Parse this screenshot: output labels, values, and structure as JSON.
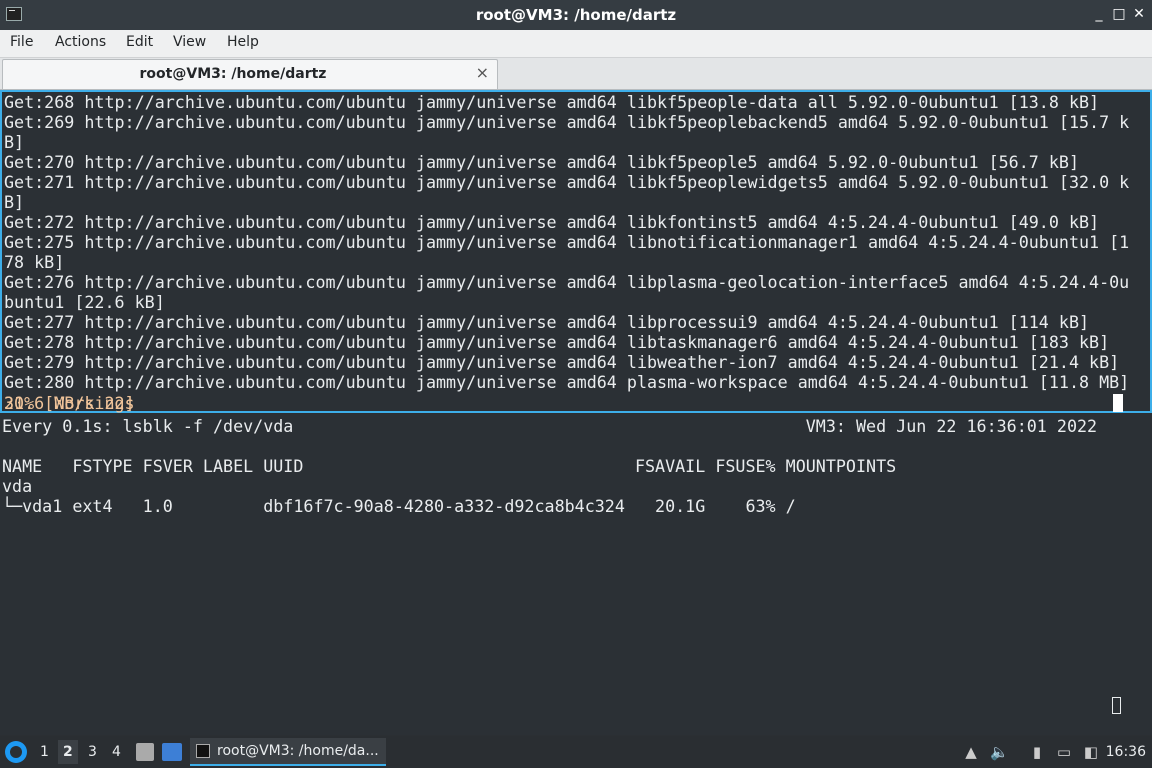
{
  "window": {
    "title": "root@VM3: /home/dartz",
    "controls": {
      "minimize": "_",
      "maximize": "□",
      "close": "✕"
    }
  },
  "menu": [
    "File",
    "Actions",
    "Edit",
    "View",
    "Help"
  ],
  "tab": {
    "label": "root@VM3: /home/dartz",
    "close": "×"
  },
  "pane1": {
    "lines": [
      "Get:268 http://archive.ubuntu.com/ubuntu jammy/universe amd64 libkf5people-data all 5.92.0-0ubuntu1 [13.8 kB]",
      "Get:269 http://archive.ubuntu.com/ubuntu jammy/universe amd64 libkf5peoplebackend5 amd64 5.92.0-0ubuntu1 [15.7 k",
      "B]",
      "Get:270 http://archive.ubuntu.com/ubuntu jammy/universe amd64 libkf5people5 amd64 5.92.0-0ubuntu1 [56.7 kB]",
      "Get:271 http://archive.ubuntu.com/ubuntu jammy/universe amd64 libkf5peoplewidgets5 amd64 5.92.0-0ubuntu1 [32.0 k",
      "B]",
      "Get:272 http://archive.ubuntu.com/ubuntu jammy/universe amd64 libkfontinst5 amd64 4:5.24.4-0ubuntu1 [49.0 kB]",
      "Get:275 http://archive.ubuntu.com/ubuntu jammy/universe amd64 libnotificationmanager1 amd64 4:5.24.4-0ubuntu1 [1",
      "78 kB]",
      "Get:276 http://archive.ubuntu.com/ubuntu jammy/universe amd64 libplasma-geolocation-interface5 amd64 4:5.24.4-0u",
      "buntu1 [22.6 kB]",
      "Get:277 http://archive.ubuntu.com/ubuntu jammy/universe amd64 libprocessui9 amd64 4:5.24.4-0ubuntu1 [114 kB]",
      "Get:278 http://archive.ubuntu.com/ubuntu jammy/universe amd64 libtaskmanager6 amd64 4:5.24.4-0ubuntu1 [183 kB]",
      "Get:279 http://archive.ubuntu.com/ubuntu jammy/universe amd64 libweather-ion7 amd64 4:5.24.4-0ubuntu1 [21.4 kB]",
      "Get:280 http://archive.ubuntu.com/ubuntu jammy/universe amd64 plasma-workspace amd64 4:5.24.4-0ubuntu1 [11.8 MB]"
    ],
    "status": "31% [Working]",
    "speed": "20.6 MB/s 22s"
  },
  "pane2": {
    "lines": [
      "Every 0.1s: lsblk -f /dev/vda                                                   VM3: Wed Jun 22 16:36:01 2022",
      "",
      "NAME   FSTYPE FSVER LABEL UUID                                 FSAVAIL FSUSE% MOUNTPOINTS",
      "vda",
      "└─vda1 ext4   1.0         dbf16f7c-90a8-4280-a332-d92ca8b4c324   20.1G    63% /"
    ]
  },
  "taskbar": {
    "workspaces": [
      "1",
      "2",
      "3",
      "4"
    ],
    "active_workspace": "2",
    "task_label": "root@VM3: /home/da...",
    "clock": "16:36"
  }
}
